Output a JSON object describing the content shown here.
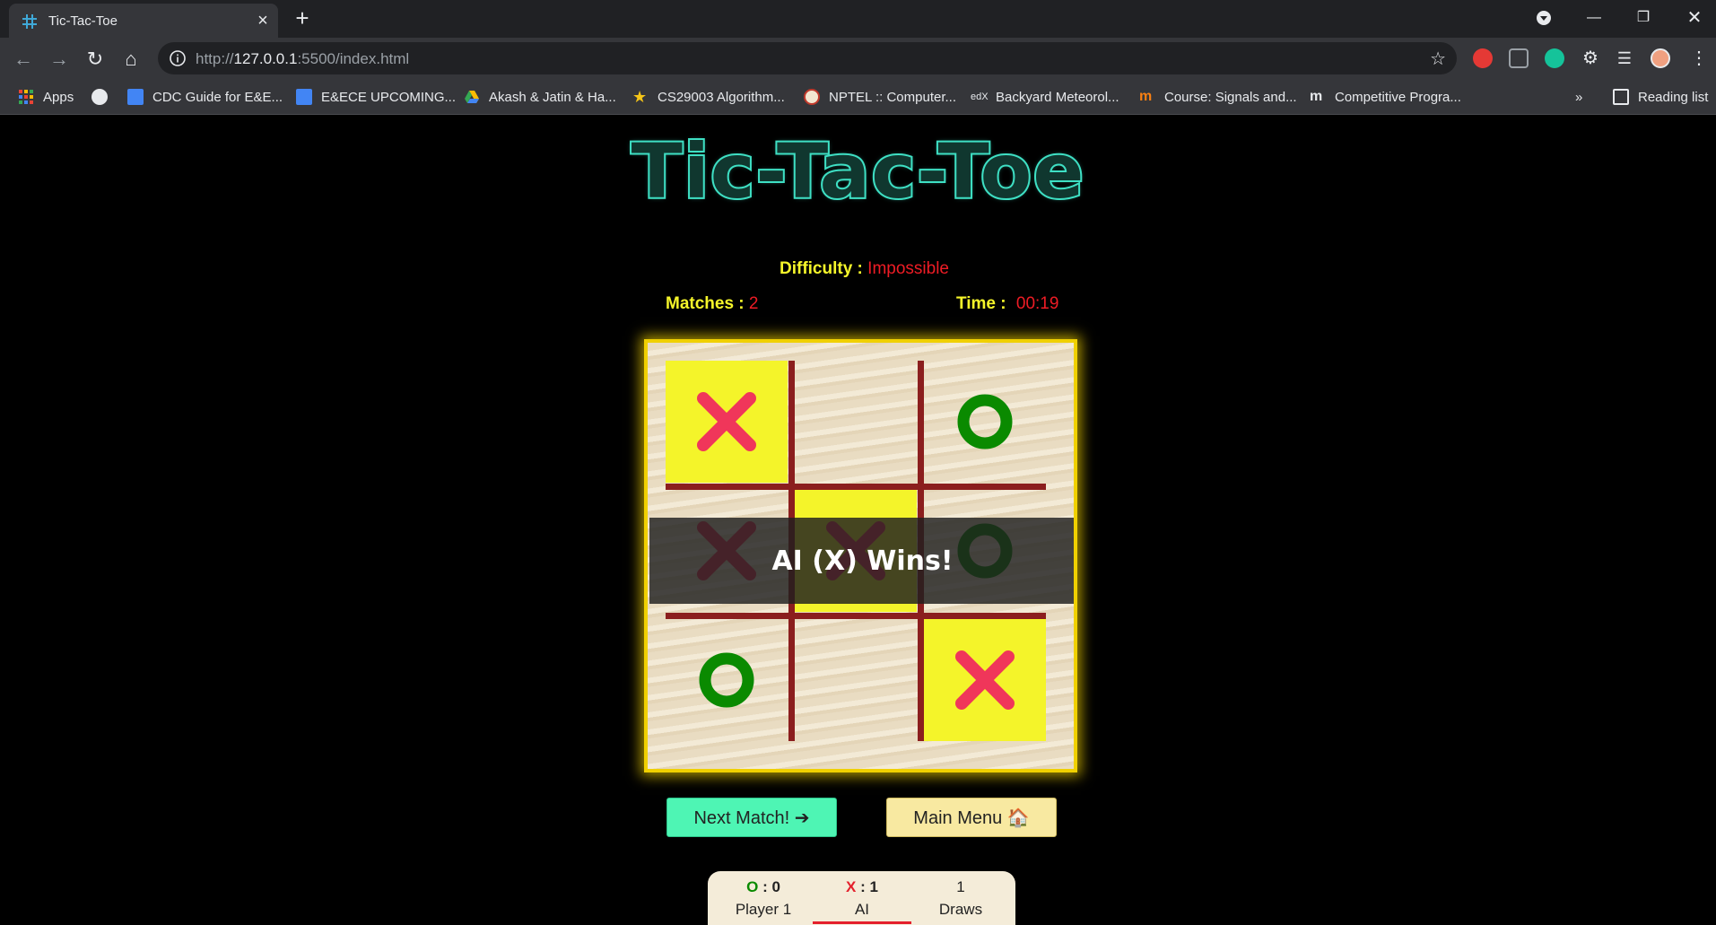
{
  "browser": {
    "tab_title": "Tic-Tac-Toe",
    "url_prefix": "http://",
    "url_host": "127.0.0.1",
    "url_rest": ":5500/index.html",
    "bookmarks": [
      {
        "label": "Apps",
        "icon": "apps-grid-icon"
      },
      {
        "label": "",
        "icon": "globe-icon"
      },
      {
        "label": "CDC Guide for E&E...",
        "icon": "google-docs-icon"
      },
      {
        "label": "E&ECE UPCOMING...",
        "icon": "google-docs-icon"
      },
      {
        "label": "Akash & Jatin & Ha...",
        "icon": "google-drive-icon"
      },
      {
        "label": "CS29003 Algorithm...",
        "icon": "star-icon"
      },
      {
        "label": "NPTEL :: Computer...",
        "icon": "nptel-icon"
      },
      {
        "label": "Backyard Meteorol...",
        "icon": "edx-icon"
      },
      {
        "label": "Course: Signals and...",
        "icon": "moodle-icon"
      },
      {
        "label": "Competitive Progra...",
        "icon": "medium-icon"
      }
    ],
    "reading_list": "Reading list",
    "overflow": "»"
  },
  "game": {
    "title": "Tic-Tac-Toe",
    "difficulty_label": "Difficulty :",
    "difficulty_value": "Impossible",
    "matches_label": "Matches :",
    "matches_value": "2",
    "time_label": "Time :",
    "time_value": "00:19",
    "board": [
      "X",
      "",
      "O",
      "X",
      "X",
      "O",
      "O",
      "",
      "X"
    ],
    "winning_cells": [
      0,
      4,
      8
    ],
    "result_text": "AI (X) Wins!",
    "next_button": "Next Match! ➔",
    "menu_button": "Main Menu 🏠",
    "colors": {
      "x": "#f0365a",
      "o": "#0a8a00",
      "highlight": "#f4f42a",
      "grid": "#8b1e1e",
      "title": "#3fe0c4"
    }
  },
  "scores": {
    "player": {
      "symbol": "O",
      "value": ": 0",
      "name": "Player 1"
    },
    "ai": {
      "symbol": "X",
      "value": ": 1",
      "name": "AI"
    },
    "draws": {
      "value": "1",
      "name": "Draws"
    }
  }
}
